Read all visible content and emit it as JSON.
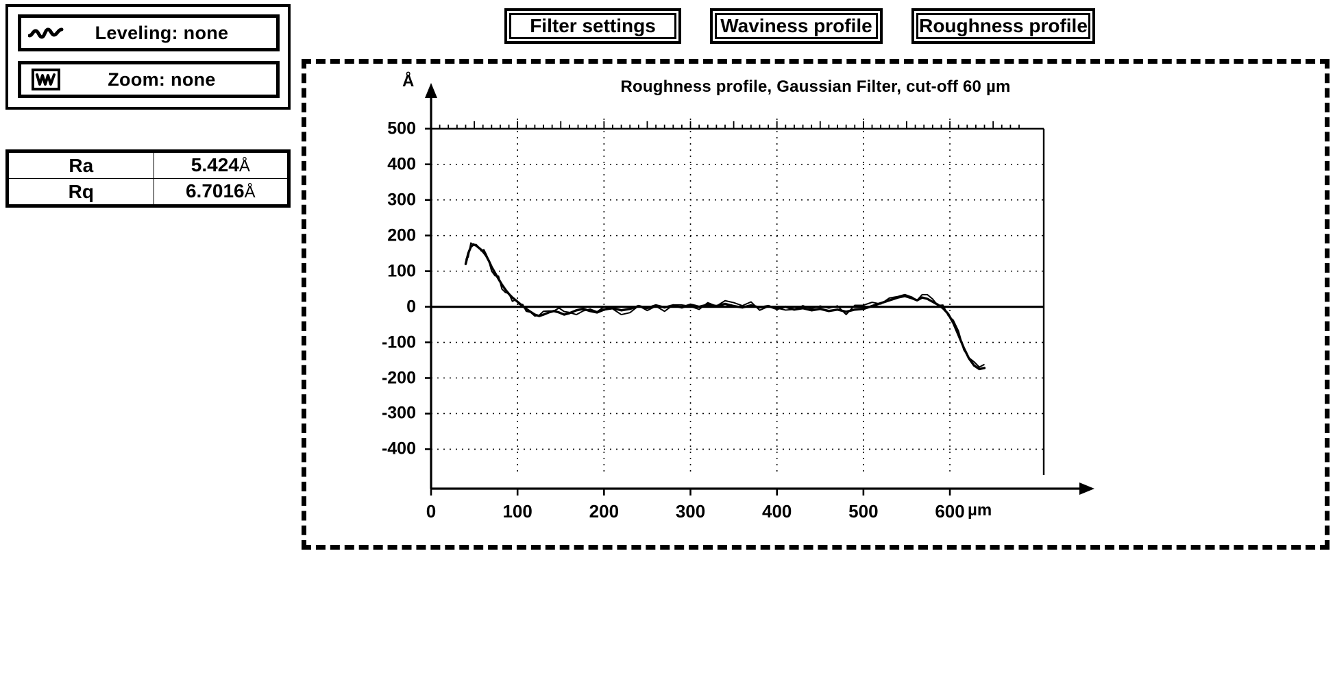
{
  "left_panel": {
    "leveling_button": {
      "label": "Leveling: none",
      "icon": "wavy-line-icon"
    },
    "zoom_button": {
      "label": "Zoom: none",
      "icon": "zoom-waveform-icon"
    }
  },
  "stats": {
    "rows": [
      {
        "name": "Ra",
        "value": "5.424",
        "unit": "Å"
      },
      {
        "name": "Rq",
        "value": "6.7016",
        "unit": "Å"
      }
    ]
  },
  "toolbar": {
    "filter_settings_label": "Filter settings",
    "waviness_profile_label": "Waviness profile",
    "roughness_profile_label": "Roughness profile"
  },
  "chart_data": {
    "type": "line",
    "title": "Roughness profile, Gaussian Filter, cut-off 60 µm",
    "xlabel": "600 µm",
    "ylabel": "Å",
    "x_unit": "µm",
    "y_unit": "Å",
    "xlim": [
      0,
      680
    ],
    "ylim": [
      -480,
      540
    ],
    "xticks": [
      0,
      100,
      200,
      300,
      400,
      500,
      600
    ],
    "xtick_labels": [
      "0",
      "100",
      "200",
      "300",
      "400",
      "500",
      "600"
    ],
    "yticks": [
      500,
      400,
      300,
      200,
      100,
      0,
      -100,
      -200,
      -300,
      -400
    ],
    "ytick_labels": [
      "500",
      "400",
      "300",
      "200",
      "100",
      "0",
      "-100",
      "-200",
      "-300",
      "-400"
    ],
    "grid": true,
    "legend": "none",
    "series": [
      {
        "name": "Roughness profile",
        "x": [
          40,
          43,
          46,
          49,
          52,
          55,
          58,
          61,
          64,
          67,
          70,
          74,
          78,
          82,
          86,
          90,
          94,
          98,
          102,
          106,
          110,
          115,
          120,
          125,
          130,
          136,
          142,
          148,
          154,
          160,
          168,
          176,
          184,
          192,
          200,
          210,
          220,
          230,
          240,
          250,
          260,
          270,
          280,
          290,
          300,
          310,
          320,
          330,
          340,
          350,
          360,
          370,
          380,
          390,
          400,
          410,
          420,
          430,
          440,
          450,
          460,
          470,
          480,
          490,
          500,
          510,
          520,
          530,
          540,
          548,
          556,
          562,
          568,
          574,
          580,
          586,
          592,
          598,
          604,
          610,
          616,
          622,
          628,
          634,
          640
        ],
        "y": [
          120,
          150,
          168,
          175,
          172,
          166,
          160,
          152,
          142,
          128,
          112,
          95,
          78,
          62,
          48,
          36,
          26,
          18,
          10,
          2,
          -6,
          -14,
          -22,
          -26,
          -22,
          -16,
          -12,
          -16,
          -22,
          -18,
          -10,
          -6,
          -12,
          -16,
          -8,
          -4,
          -10,
          -6,
          2,
          -4,
          4,
          -2,
          4,
          -2,
          6,
          0,
          6,
          2,
          8,
          2,
          -2,
          4,
          -2,
          2,
          -6,
          0,
          -8,
          -4,
          -10,
          -6,
          -12,
          -8,
          -14,
          -8,
          -6,
          2,
          10,
          18,
          26,
          30,
          24,
          18,
          26,
          22,
          14,
          6,
          -4,
          -20,
          -46,
          -80,
          -115,
          -145,
          -165,
          -175,
          -172
        ]
      }
    ]
  }
}
